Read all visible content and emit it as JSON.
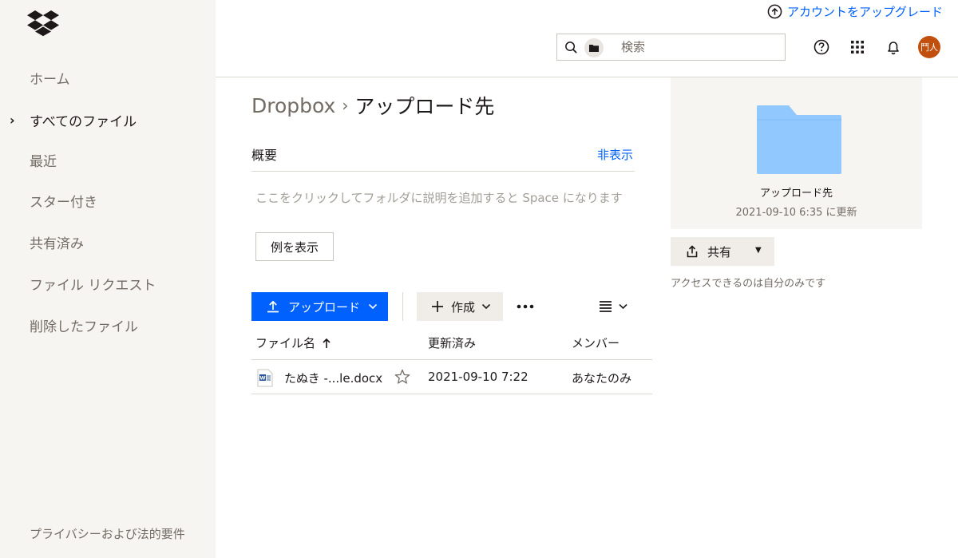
{
  "sidebar": {
    "items": [
      {
        "label": "ホーム"
      },
      {
        "label": "すべてのファイル"
      },
      {
        "label": "最近"
      },
      {
        "label": "スター付き"
      },
      {
        "label": "共有済み"
      },
      {
        "label": "ファイル リクエスト"
      },
      {
        "label": "削除したファイル"
      }
    ],
    "footer": "プライバシーおよび法的要件"
  },
  "header": {
    "upgrade_label": "アカウントをアップグレード",
    "search_placeholder": "検索",
    "avatar_text": "鬥人"
  },
  "breadcrumb": {
    "root": "Dropbox",
    "separator": "›",
    "current": "アップロード先"
  },
  "overview": {
    "title": "概要",
    "hide_label": "非表示",
    "description": "ここをクリックしてフォルダに説明を追加すると Space になります",
    "example_button": "例を表示"
  },
  "toolbar": {
    "upload_label": "アップロード",
    "create_label": "作成"
  },
  "table": {
    "headers": {
      "name": "ファイル名",
      "modified": "更新済み",
      "members": "メンバー"
    },
    "rows": [
      {
        "name": "たぬき -...le.docx",
        "modified": "2021-09-10 7:22",
        "members": "あなたのみ"
      }
    ]
  },
  "details": {
    "folder_name": "アップロード先",
    "updated": "2021-09-10 6:35 に更新",
    "share_label": "共有",
    "access_note": "アクセスできるのは自分のみです"
  },
  "colors": {
    "accent": "#0061fe",
    "sidebar_bg": "#f7f5f2",
    "folder": "#91c9ff",
    "avatar": "#c14f0d"
  },
  "icons": [
    "dropbox-logo-icon",
    "upgrade-arrow-icon",
    "search-icon",
    "folder-icon",
    "help-icon",
    "apps-grid-icon",
    "bell-icon",
    "upload-icon",
    "plus-icon",
    "chevron-down-icon",
    "more-icon",
    "list-view-icon",
    "sort-up-icon",
    "word-file-icon",
    "star-icon",
    "share-icon"
  ]
}
